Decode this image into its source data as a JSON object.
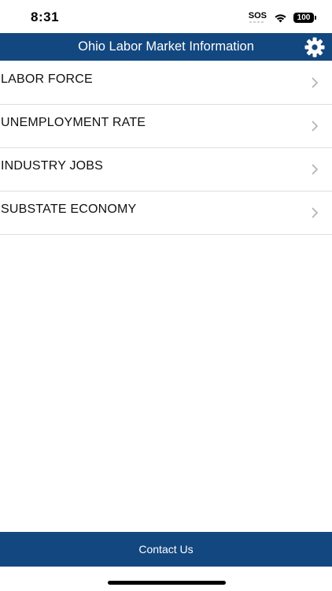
{
  "status_bar": {
    "time": "8:31",
    "sos": "SOS",
    "battery": "100"
  },
  "header": {
    "title": "Ohio Labor Market Information",
    "settings_icon": "gear-icon"
  },
  "menu": {
    "items": [
      {
        "label": "LABOR FORCE"
      },
      {
        "label": "UNEMPLOYMENT RATE"
      },
      {
        "label": "INDUSTRY JOBS"
      },
      {
        "label": "SUBSTATE ECONOMY"
      }
    ],
    "chevron_icon": "chevron-right-icon"
  },
  "footer": {
    "contact_label": "Contact Us"
  },
  "colors": {
    "brand": "#13477f",
    "background": "#ffffff",
    "divider": "#dedede"
  }
}
